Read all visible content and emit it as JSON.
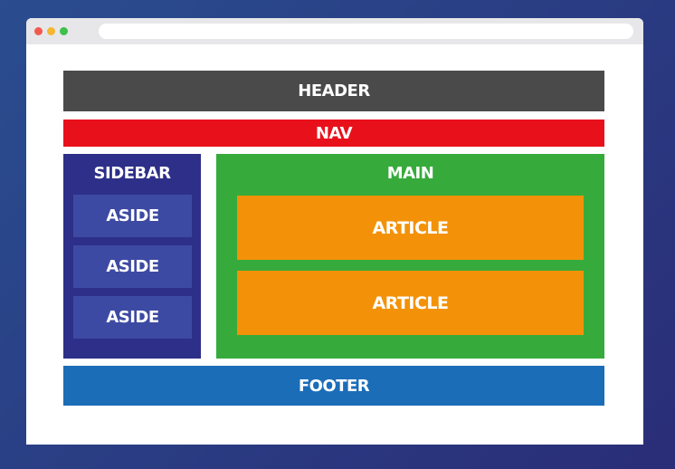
{
  "colors": {
    "background_start": "#2a4d8f",
    "background_end": "#2a2d78",
    "titlebar": "#e7e7e9",
    "dot_red": "#f05a4e",
    "dot_yellow": "#f5b731",
    "dot_green": "#3fc04a",
    "header": "#4a4a4a",
    "nav": "#e8111b",
    "sidebar": "#2d2f88",
    "aside": "#3d4aa3",
    "main": "#37aa3c",
    "article": "#f39208",
    "footer": "#1b6db8"
  },
  "icons": {
    "close": "red-dot-icon",
    "minimize": "yellow-dot-icon",
    "maximize": "green-dot-icon"
  },
  "layout_labels": {
    "header": "HEADER",
    "nav": "NAV",
    "sidebar": "SIDEBAR",
    "asides": [
      "ASIDE",
      "ASIDE",
      "ASIDE"
    ],
    "main": "MAIN",
    "articles": [
      "ARTICLE",
      "ARTICLE"
    ],
    "footer": "FOOTER"
  }
}
